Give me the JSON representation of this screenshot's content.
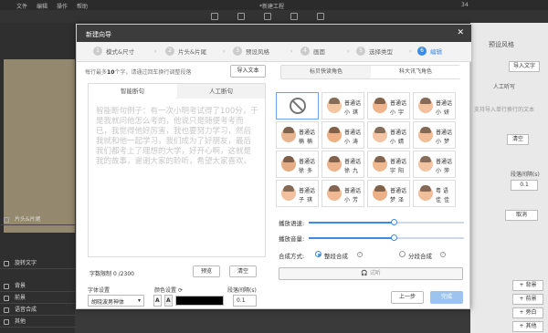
{
  "app": {
    "menu": [
      "文件",
      "编辑",
      "操作",
      "帮助"
    ],
    "title": "*新建工程",
    "counter": "34"
  },
  "left": {
    "tracks": [
      "旋转文字",
      "背景",
      "前景",
      "语音合成",
      "其他"
    ],
    "timeline_label": "片头&片尾",
    "timeline_tab": "前景"
  },
  "right": {
    "tab": "预设风格",
    "btn1": "导入文字",
    "label1": "人工听写",
    "text1": "支持导入单行换行的文本",
    "btn2": "清空",
    "label2": "段落间隔(s)",
    "val2": "0.1",
    "btn3": "取消",
    "add_buttons": [
      "+ 背景",
      "+ 前景",
      "+ 旁白",
      "+ 其他"
    ]
  },
  "dialog": {
    "title": "新建向导",
    "steps": [
      {
        "n": "1",
        "label": "模式&尺寸"
      },
      {
        "n": "2",
        "label": "片头&片尾"
      },
      {
        "n": "3",
        "label": "预设风格"
      },
      {
        "n": "4",
        "label": "画面"
      },
      {
        "n": "5",
        "label": "选择类型"
      },
      {
        "n": "6",
        "label": "编辑"
      }
    ],
    "hint_prefix": "每行最多",
    "hint_num": "10",
    "hint_suffix": "个字，请通过回车换行调整段落",
    "import_btn": "导入文本",
    "edit_tabs": [
      "智能断句",
      "人工断句"
    ],
    "edit_text": "智能断句例子：有一次小明考试得了100分，于是我就问他怎么考的，他说只是随便考考而已，我觉得他好厉害，我也要努力学习，然后我就和他一起学习，我们成为了好朋友，最后我们都考上了理想的大学，好开心啊，这就是我的故事，谢谢大家的聆听，希望大家喜欢。",
    "count_label": "字数限制",
    "count_value": "0 /2300",
    "preview_btn": "预览",
    "clear_btn": "清空",
    "font_label": "字体设置",
    "font_value": "胡晓波男神体",
    "color_label": "颜色设置",
    "spacing_label": "段落间隔(s)",
    "spacing_value": "0.1",
    "voice_tabs": [
      "标贝快读角色",
      "科大讯飞角色"
    ],
    "voices": [
      {
        "l1": "普通话",
        "l2": "小琪",
        "color": "#f2c6a0"
      },
      {
        "l1": "普通话",
        "l2": "小宇",
        "color": "#f0b48c"
      },
      {
        "l1": "普通话",
        "l2": "小妍",
        "color": "#f3c19e"
      },
      {
        "l1": "普通话",
        "l2": "楠楠",
        "color": "#e8b48f"
      },
      {
        "l1": "普通话",
        "l2": "小涛",
        "color": "#efb085"
      },
      {
        "l1": "普通话",
        "l2": "小婧",
        "color": "#f4c4a5"
      },
      {
        "l1": "普通话",
        "l2": "小梦",
        "color": "#f1bd99"
      },
      {
        "l1": "普通话",
        "l2": "徐多",
        "color": "#e6ad84"
      },
      {
        "l1": "普通话",
        "l2": "徐九",
        "color": "#edb38c"
      },
      {
        "l1": "普通话",
        "l2": "宇阳",
        "color": "#efb88f"
      },
      {
        "l1": "普通话",
        "l2": "小萍",
        "color": "#f3c4a2"
      },
      {
        "l1": "普通话",
        "l2": "子琪",
        "color": "#f2c09c"
      },
      {
        "l1": "普通话",
        "l2": "小芳",
        "color": "#f0b893"
      },
      {
        "l1": "普通话",
        "l2": "梦泽",
        "color": "#ecb087"
      },
      {
        "l1": "粤 语",
        "l2": "佳佳",
        "color": "#f1be9a"
      }
    ],
    "rate_label": "播放语速:",
    "rate_value": 0.55,
    "volume_label": "播放音量:",
    "volume_value": 0.55,
    "synth_label": "合成方式:",
    "synth_opt1": "整段合成",
    "synth_opt2": "分段合成",
    "mic_label": "试听",
    "prev_btn": "上一步",
    "finish_btn": "完成",
    "accent": "#3b8ce6"
  }
}
